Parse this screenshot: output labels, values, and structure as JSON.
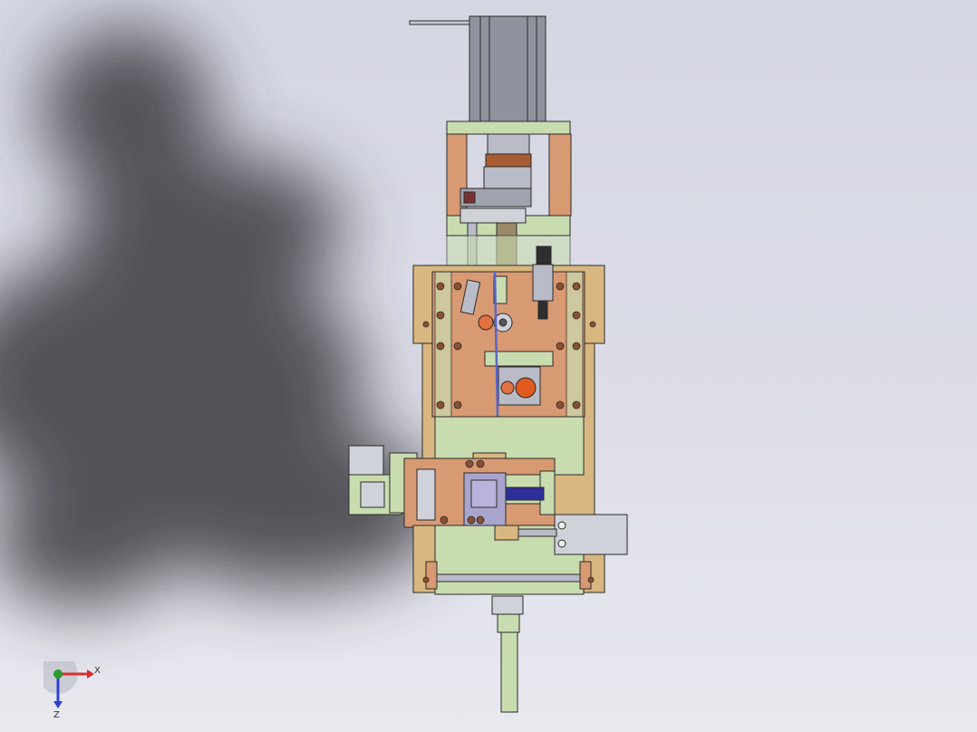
{
  "viewport": {
    "background_top": "#d4d6e2",
    "background_bottom": "#e8e9ef",
    "part_colors": {
      "copper": "#d89a72",
      "green": "#c9dcb0",
      "tan": "#d8b780",
      "steel": "#b9bcc7",
      "purple": "#a8a4cc",
      "motor": "#8f939e"
    }
  },
  "triad": {
    "x_label": "X",
    "z_label": "Z",
    "x_color": "#d63030",
    "y_color": "#2a9a2a",
    "z_color": "#2d3fd0"
  }
}
